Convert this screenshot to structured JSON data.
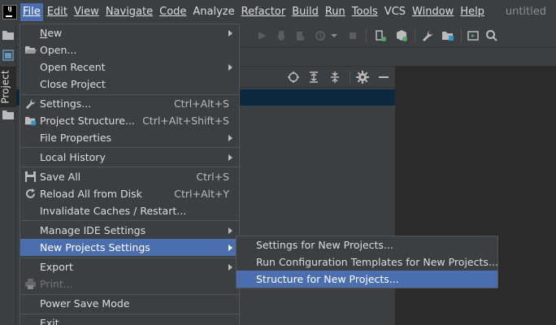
{
  "app": {
    "logo": "IJ",
    "window_title": "untitled"
  },
  "menubar": {
    "items": [
      {
        "label": "File",
        "active": true
      },
      {
        "label": "Edit"
      },
      {
        "label": "View"
      },
      {
        "label": "Navigate"
      },
      {
        "label": "Code"
      },
      {
        "label": "Analyze"
      },
      {
        "label": "Refactor"
      },
      {
        "label": "Build"
      },
      {
        "label": "Run"
      },
      {
        "label": "Tools"
      },
      {
        "label": "VCS"
      },
      {
        "label": "Window"
      },
      {
        "label": "Help"
      }
    ]
  },
  "left_strip": {
    "project_tab": "Project"
  },
  "file_menu": {
    "items": [
      {
        "label": "New",
        "submenu": true
      },
      {
        "label": "Open...",
        "icon": "folder-open-icon"
      },
      {
        "label": "Open Recent",
        "submenu": true
      },
      {
        "label": "Close Project"
      },
      {
        "label": "Settings...",
        "shortcut": "Ctrl+Alt+S",
        "icon": "wrench-icon"
      },
      {
        "label": "Project Structure...",
        "shortcut": "Ctrl+Alt+Shift+S",
        "icon": "project-structure-icon"
      },
      {
        "label": "File Properties",
        "submenu": true
      },
      {
        "label": "Local History",
        "submenu": true
      },
      {
        "label": "Save All",
        "shortcut": "Ctrl+S",
        "icon": "save-icon"
      },
      {
        "label": "Reload All from Disk",
        "shortcut": "Ctrl+Alt+Y",
        "icon": "reload-icon"
      },
      {
        "label": "Invalidate Caches / Restart..."
      },
      {
        "label": "Manage IDE Settings",
        "submenu": true
      },
      {
        "label": "New Projects Settings",
        "submenu": true,
        "selected": true
      },
      {
        "label": "Export",
        "submenu": true
      },
      {
        "label": "Print...",
        "disabled": true,
        "icon": "print-icon"
      },
      {
        "label": "Power Save Mode"
      },
      {
        "label": "Exit"
      }
    ]
  },
  "sub_menu": {
    "items": [
      {
        "label": "Settings for New Projects..."
      },
      {
        "label": "Run Configuration Templates for New Projects..."
      },
      {
        "label": "Structure for New Projects...",
        "selected": true
      }
    ]
  },
  "colors": {
    "background": "#3c3f41",
    "selection": "#4b6eaf",
    "editor": "#2b2b2b",
    "tree_selection": "#0d293e"
  }
}
